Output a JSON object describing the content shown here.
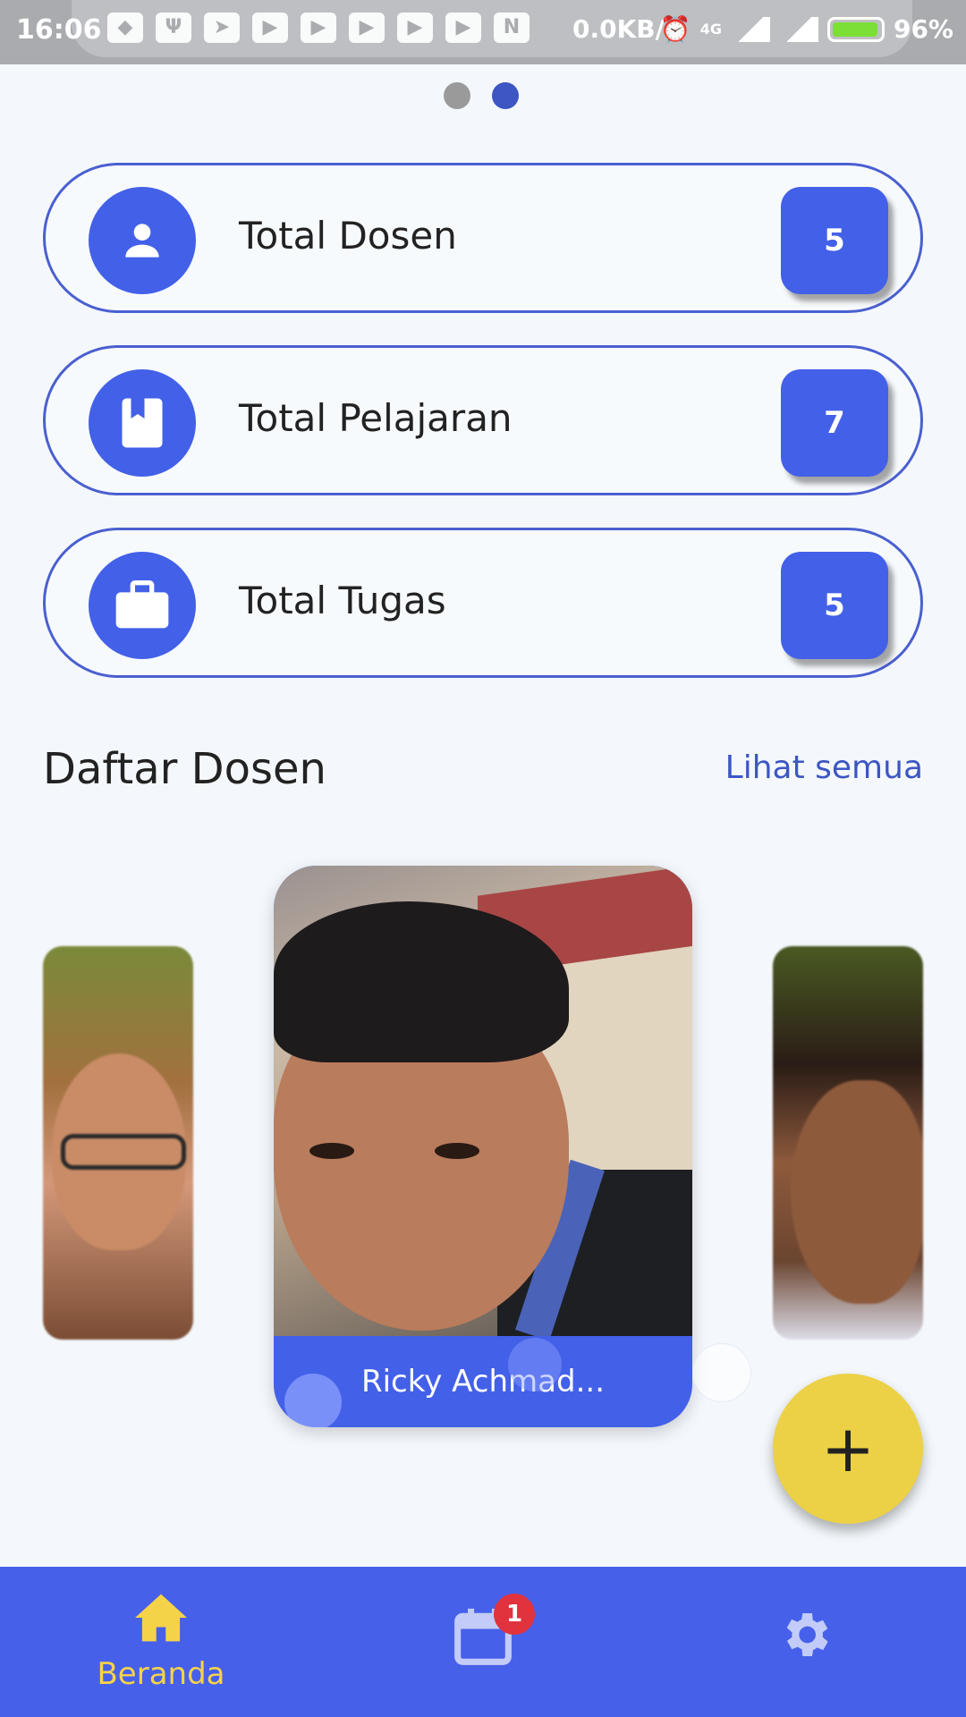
{
  "status_bar": {
    "time": "16:06",
    "network_speed": "0.0KB/s",
    "network_type": "4G",
    "battery": "96%",
    "notification_icons": [
      "shield-icon",
      "usb-icon",
      "telegram-icon",
      "youtube-icon",
      "youtube-icon",
      "youtube-icon",
      "youtube-icon",
      "youtube-icon",
      "n-icon"
    ]
  },
  "pager": {
    "count": 2,
    "active_index": 1
  },
  "stats": [
    {
      "label": "Total Dosen",
      "count": "5",
      "icon": "person-icon"
    },
    {
      "label": "Total Pelajaran",
      "count": "7",
      "icon": "book-icon"
    },
    {
      "label": "Total Tugas",
      "count": "5",
      "icon": "briefcase-icon"
    }
  ],
  "section": {
    "title": "Daftar Dosen",
    "see_all": "Lihat semua"
  },
  "carousel": {
    "center_name": "Ricky Achmad..."
  },
  "fab": {
    "label": "+"
  },
  "bottom_nav": {
    "items": [
      {
        "label": "Beranda",
        "icon": "home-icon",
        "active": true
      },
      {
        "label": "",
        "icon": "calendar-icon",
        "badge": "1"
      },
      {
        "label": "",
        "icon": "gear-icon"
      }
    ]
  },
  "colors": {
    "primary": "#4360e8",
    "accent": "#ecd146",
    "badge": "#e0333e",
    "background": "#f4f8fc"
  }
}
